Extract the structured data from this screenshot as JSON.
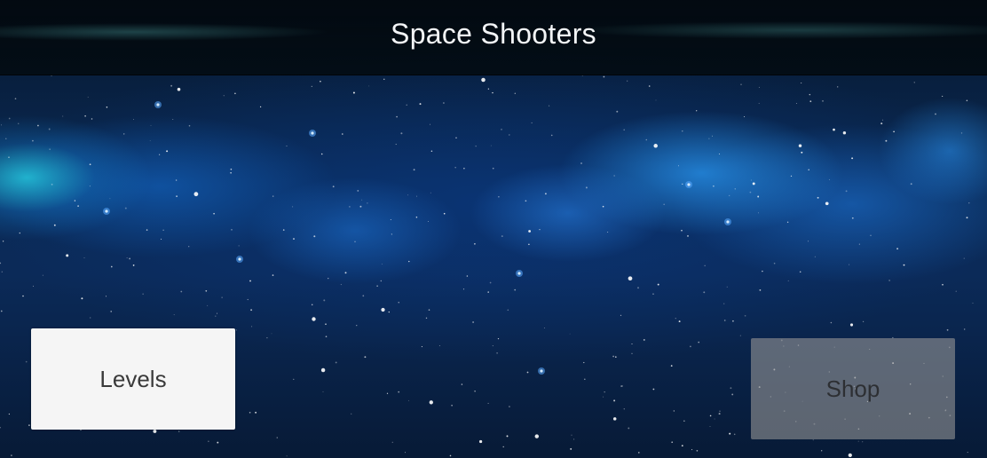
{
  "header": {
    "title": "Space Shooters"
  },
  "menu": {
    "levels_label": "Levels",
    "shop_label": "Shop",
    "shop_state": "disabled"
  },
  "colors": {
    "background_space": "#0b2a58",
    "nebula_highlight": "#28dcf0",
    "title_text": "#f2f4f6",
    "button_enabled": "#f5f5f5",
    "button_disabled": "#969696"
  }
}
